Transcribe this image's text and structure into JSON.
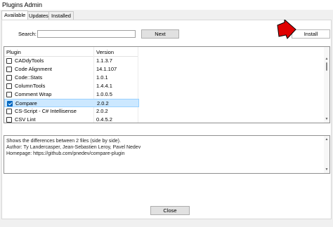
{
  "window": {
    "title": "Plugins Admin"
  },
  "tabs": [
    {
      "label": "Available",
      "active": true
    },
    {
      "label": "Updates",
      "active": false
    },
    {
      "label": "Installed",
      "active": false
    }
  ],
  "search": {
    "label": "Search:",
    "value": ""
  },
  "buttons": {
    "next": "Next",
    "install": "Install",
    "close": "Close"
  },
  "list": {
    "columns": [
      "Plugin",
      "Version"
    ],
    "rows": [
      {
        "name": "CADdyTools",
        "version": "1.1.3.7",
        "checked": false,
        "selected": false
      },
      {
        "name": "Code Alignment",
        "version": "14.1.107",
        "checked": false,
        "selected": false
      },
      {
        "name": "Code::Stats",
        "version": "1.0.1",
        "checked": false,
        "selected": false
      },
      {
        "name": "ColumnTools",
        "version": "1.4.4.1",
        "checked": false,
        "selected": false
      },
      {
        "name": "Comment Wrap",
        "version": "1.0.0.5",
        "checked": false,
        "selected": false
      },
      {
        "name": "Compare",
        "version": "2.0.2",
        "checked": true,
        "selected": true
      },
      {
        "name": "CS-Script - C# Intellisense",
        "version": "2.0.2",
        "checked": false,
        "selected": false
      },
      {
        "name": "CSV Lint",
        "version": "0.4.5.2",
        "checked": false,
        "selected": false
      }
    ]
  },
  "description": {
    "lines": [
      "Shows the differences between 2 files (side by side).",
      "Author: Ty Landercasper, Jean-Sebastien Leroy, Pavel Nedev",
      "Homepage: https://github.com/pnedev/compare-plugin"
    ]
  },
  "colors": {
    "selection": "#cce8ff",
    "check": "#0067c0",
    "arrow": "#e00000"
  }
}
